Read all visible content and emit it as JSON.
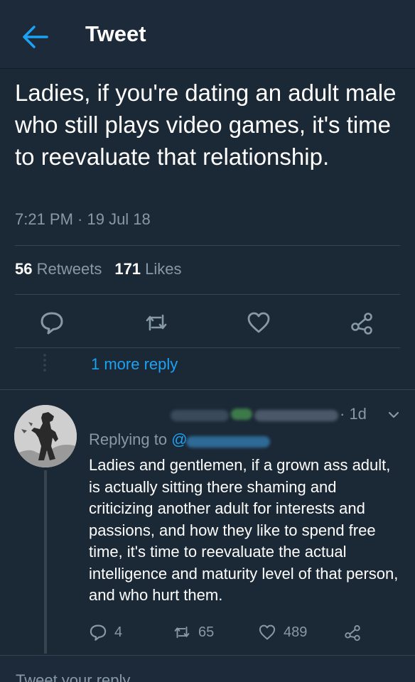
{
  "header": {
    "title": "Tweet"
  },
  "tweet": {
    "text": "Ladies, if you're dating an adult male who still plays video games, it's time to reevaluate that relationship.",
    "timestamp": "7:21 PM · 19 Jul 18",
    "retweets_count": "56",
    "retweets_label": "Retweets",
    "likes_count": "171",
    "likes_label": "Likes"
  },
  "thread": {
    "more_replies": "1 more reply"
  },
  "reply": {
    "time": "· 1d",
    "replying_prefix": "Replying to",
    "replying_handle": "@",
    "text": "Ladies and gentlemen, if a grown ass adult, is actually sitting there shaming and criticizing another adult for interests and passions, and how they like to spend free time, it's time to reevaluate the actual intelligence and maturity level of that person, and who hurt them.",
    "reply_count": "4",
    "retweet_count": "65",
    "like_count": "489"
  },
  "composer": {
    "placeholder": "Tweet your reply"
  },
  "colors": {
    "background": "#1b2836",
    "accent": "#1da1f2",
    "secondary_text": "#8899a6",
    "divider": "#38444d"
  },
  "icons": {
    "back": "arrow-left-icon",
    "reply": "speech-bubble-icon",
    "retweet": "retweet-icon",
    "like": "heart-icon",
    "share": "share-icon",
    "menu": "chevron-down-icon"
  }
}
